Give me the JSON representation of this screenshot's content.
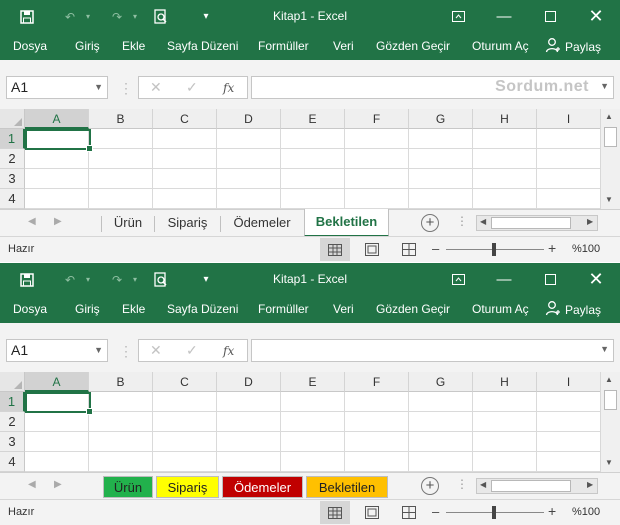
{
  "colors": {
    "accent": "#217346",
    "tab_green": "#22b14c",
    "tab_yellow": "#ffff00",
    "tab_red": "#c00000",
    "tab_orange": "#ffc000"
  },
  "screens": [
    {
      "title": "Kitap1 - Excel",
      "menu": [
        "Dosya",
        "Giriş",
        "Ekle",
        "Sayfa Düzeni",
        "Formüller",
        "Veri",
        "Gözden Geçir",
        "Oturum Aç"
      ],
      "share_label": "Paylaş",
      "name_box": "A1",
      "formula_text": "Sordum.net",
      "columns": [
        "A",
        "B",
        "C",
        "D",
        "E",
        "F",
        "G",
        "H",
        "I"
      ],
      "rows": [
        "1",
        "2",
        "3",
        "4"
      ],
      "sheet_tabs": [
        {
          "label": "Ürün",
          "state": "plain"
        },
        {
          "label": "Sipariş",
          "state": "plain"
        },
        {
          "label": "Ödemeler",
          "state": "plain"
        },
        {
          "label": "Bekletilen",
          "state": "active"
        }
      ],
      "status": "Hazır",
      "zoom": "%100",
      "icons": [
        "save-icon",
        "undo-icon",
        "redo-icon",
        "print-preview-icon",
        "customize-toolbar-icon",
        "ribbon-display-icon",
        "minimize-icon",
        "maximize-icon",
        "close-icon",
        "user-icon"
      ]
    },
    {
      "title": "Kitap1 - Excel",
      "menu": [
        "Dosya",
        "Giriş",
        "Ekle",
        "Sayfa Düzeni",
        "Formüller",
        "Veri",
        "Gözden Geçir",
        "Oturum Aç"
      ],
      "share_label": "Paylaş",
      "name_box": "A1",
      "formula_text": "",
      "columns": [
        "A",
        "B",
        "C",
        "D",
        "E",
        "F",
        "G",
        "H",
        "I"
      ],
      "rows": [
        "1",
        "2",
        "3",
        "4"
      ],
      "sheet_tabs": [
        {
          "label": "Ürün",
          "state": "colored",
          "color": "#22b14c"
        },
        {
          "label": "Sipariş",
          "state": "colored",
          "color": "#ffff00"
        },
        {
          "label": "Ödemeler",
          "state": "colored",
          "color": "#c00000"
        },
        {
          "label": "Bekletilen",
          "state": "colored",
          "color": "#ffc000"
        }
      ],
      "status": "Hazır",
      "zoom": "%100",
      "icons": [
        "save-icon",
        "undo-icon",
        "redo-icon",
        "print-preview-icon",
        "customize-toolbar-icon",
        "ribbon-display-icon",
        "minimize-icon",
        "maximize-icon",
        "close-icon",
        "user-icon"
      ]
    }
  ]
}
